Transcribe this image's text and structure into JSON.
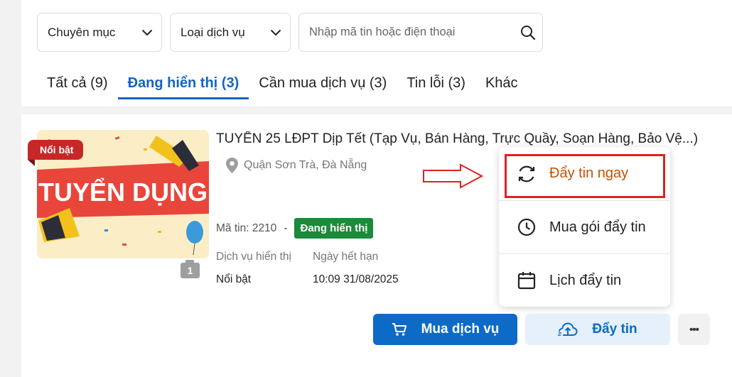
{
  "filters": {
    "category_label": "Chuyên mục",
    "service_type_label": "Loại dịch vụ",
    "search_placeholder": "Nhập mã tin hoặc điện thoại"
  },
  "tabs": [
    {
      "label": "Tất cả (9)",
      "active": false
    },
    {
      "label": "Đang hiển thị (3)",
      "active": true
    },
    {
      "label": "Cần mua dịch vụ (3)",
      "active": false
    },
    {
      "label": "Tin lỗi (3)",
      "active": false
    },
    {
      "label": "Khác",
      "active": false
    }
  ],
  "listing": {
    "badge": "Nổi bật",
    "thumbnail_text": "TUYỂN DỤNG",
    "photo_count": "1",
    "title": "TUYỂN 25 LĐPT Dịp Tết (Tạp Vụ, Bán Hàng, Trực Quầy, Soạn Hàng, Bảo Vệ...)",
    "location": "Quận Sơn Trà, Đà Nẵng",
    "id_label": "Mã tin: 2210",
    "id_separator": "-",
    "status": "Đang hiển thị",
    "service_label": "Dịch vụ hiển thị",
    "service_value": "Nổi bật",
    "expiry_label": "Ngày hết hạn",
    "expiry_value": "10:09 31/08/2025"
  },
  "actions": {
    "buy_service": "Mua dịch vụ",
    "push": "Đẩy tin",
    "more": "•••"
  },
  "dropdown": {
    "items": [
      {
        "label": "Đẩy tin ngay",
        "icon": "refresh-icon"
      },
      {
        "label": "Mua gói đẩy tin",
        "icon": "clock-icon"
      },
      {
        "label": "Lịch đẩy tin",
        "icon": "calendar-icon"
      }
    ]
  },
  "colors": {
    "primary": "#0d6ac7",
    "status_green": "#1b8a3a",
    "badge_red": "#c62828",
    "highlight_red": "#dd2222",
    "push_now_orange": "#c75000"
  }
}
